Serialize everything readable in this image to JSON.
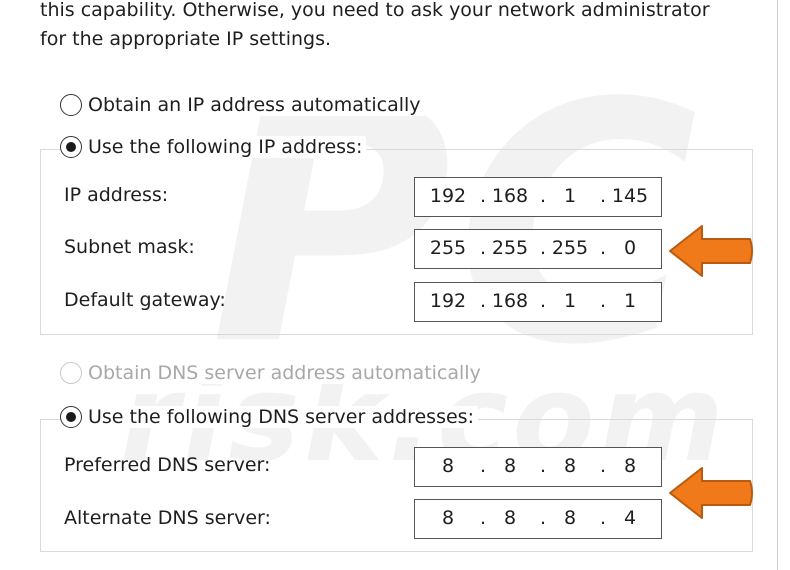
{
  "intro": {
    "line1": "this capability. Otherwise, you need to ask your network administrator",
    "line2": "for the appropriate IP settings."
  },
  "ip_section": {
    "obtain_auto_label": "Obtain an IP address automatically",
    "use_following_label": "Use the following IP address:",
    "obtain_auto_checked": false,
    "use_following_checked": true,
    "fields": {
      "ip_address": {
        "label": "IP address:",
        "octets": [
          "192",
          "168",
          "1",
          "145"
        ]
      },
      "subnet_mask": {
        "label": "Subnet mask:",
        "octets": [
          "255",
          "255",
          "255",
          "0"
        ]
      },
      "default_gateway": {
        "label": "Default gateway:",
        "octets": [
          "192",
          "168",
          "1",
          "1"
        ]
      }
    }
  },
  "dns_section": {
    "obtain_auto_label": "Obtain DNS server address automatically",
    "obtain_auto_disabled": true,
    "use_following_label": "Use the following DNS server addresses:",
    "use_following_checked": true,
    "fields": {
      "preferred": {
        "label": "Preferred DNS server:",
        "octets": [
          "8",
          "8",
          "8",
          "8"
        ]
      },
      "alternate": {
        "label": "Alternate DNS server:",
        "octets": [
          "8",
          "8",
          "8",
          "4"
        ]
      }
    }
  },
  "colors": {
    "arrow_fill": "#f07a1a",
    "arrow_stroke": "#b85a10"
  },
  "watermark": {
    "logo_text": "PC",
    "site_text": "risk.com"
  }
}
